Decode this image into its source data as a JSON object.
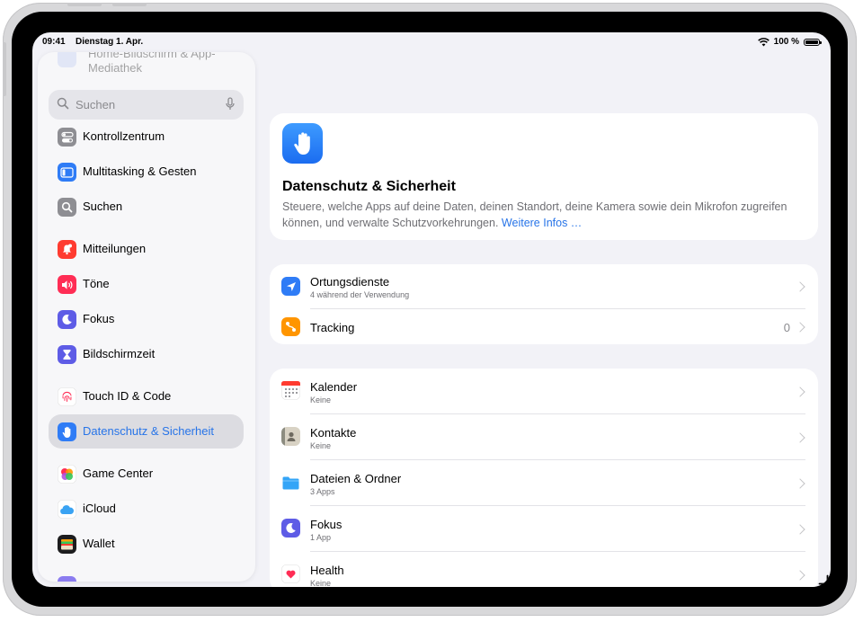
{
  "status": {
    "time": "09:41",
    "date": "Dienstag 1. Apr.",
    "battery": "100 %"
  },
  "sidebar": {
    "partial_item": "Home-Bildschirm & App-Mediathek",
    "search_placeholder": "Suchen",
    "items": [
      {
        "label": "Kontrollzentrum",
        "icon": "switches-icon",
        "color": "#8e8e93"
      },
      {
        "label": "Multitasking & Gesten",
        "icon": "multitasking-icon",
        "color": "#2f7cf6"
      },
      {
        "label": "Suchen",
        "icon": "search-icon",
        "color": "#8e8e93"
      },
      {
        "label": "Mitteilungen",
        "icon": "bell-icon",
        "color": "#ff3b30"
      },
      {
        "label": "Töne",
        "icon": "speaker-icon",
        "color": "#ff2d55"
      },
      {
        "label": "Fokus",
        "icon": "moon-icon",
        "color": "#5e5ce6"
      },
      {
        "label": "Bildschirmzeit",
        "icon": "hourglass-icon",
        "color": "#5e5ce6"
      },
      {
        "label": "Touch ID & Code",
        "icon": "fingerprint-icon",
        "color": "#ff2d55"
      },
      {
        "label": "Datenschutz & Sicherheit",
        "icon": "hand-icon",
        "color": "#2f7cf6",
        "selected": true
      },
      {
        "label": "Game Center",
        "icon": "game-center-icon",
        "color": "#ff9500"
      },
      {
        "label": "iCloud",
        "icon": "cloud-icon",
        "color": "#5ac8fa"
      },
      {
        "label": "Wallet",
        "icon": "wallet-icon",
        "color": "#1c1c1e"
      }
    ]
  },
  "hero": {
    "title": "Datenschutz & Sicherheit",
    "description": "Steuere, welche Apps auf deine Daten, deinen Standort, deine Kamera sowie dein Mikrofon zugreifen können, und verwalte Schutzvorkehrungen.",
    "link": "Weitere Infos …"
  },
  "group1": [
    {
      "title": "Ortungsdienste",
      "subtitle": "4 während der Verwendung",
      "icon": "location-arrow-icon",
      "color": "#2f7cf6"
    },
    {
      "title": "Tracking",
      "value": "0",
      "icon": "tracking-icon",
      "color": "#ff9500"
    }
  ],
  "group2": [
    {
      "title": "Kalender",
      "subtitle": "Keine",
      "icon": "calendar-icon"
    },
    {
      "title": "Kontakte",
      "subtitle": "Keine",
      "icon": "contacts-icon"
    },
    {
      "title": "Dateien & Ordner",
      "subtitle": "3 Apps",
      "icon": "folder-icon"
    },
    {
      "title": "Fokus",
      "subtitle": "1 App",
      "icon": "moon-icon"
    },
    {
      "title": "Health",
      "subtitle": "Keine",
      "icon": "heart-icon"
    }
  ]
}
